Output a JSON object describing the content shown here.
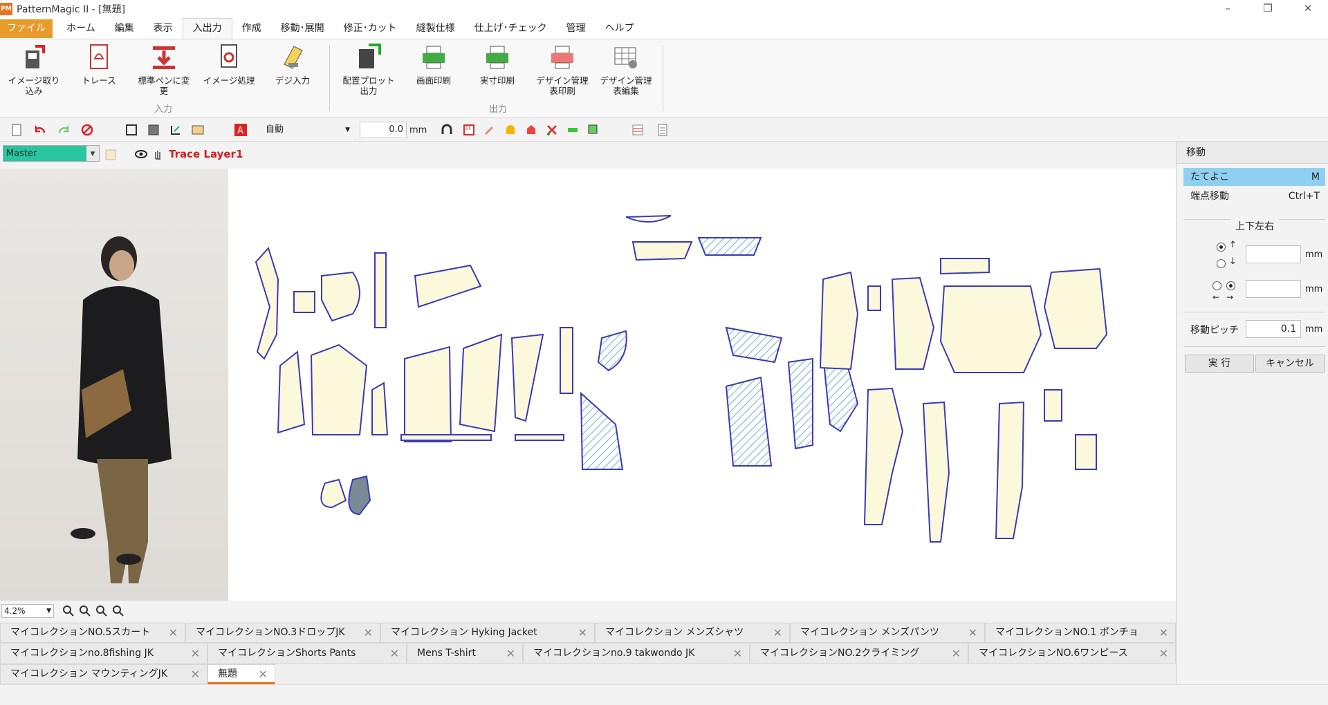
{
  "window": {
    "title": "PatternMagic II - [無題]",
    "app_icon_text": "PM"
  },
  "menu": [
    "ファイル",
    "ホーム",
    "編集",
    "表示",
    "入出力",
    "作成",
    "移動･展開",
    "修正･カット",
    "縫製仕様",
    "仕上げ･チェック",
    "管理",
    "ヘルプ"
  ],
  "ribbon": {
    "input_group_label": "入力",
    "output_group_label": "出力",
    "buttons": {
      "image_import": "イメージ取り込み",
      "trace": "トレース",
      "standard_pen": "標準ペンに変更",
      "image_process": "イメージ処理",
      "digitizer": "デジ入力",
      "plot_output": "配置プロット出力",
      "screen_print": "画面印刷",
      "actual_print": "実寸印刷",
      "design_print": "デザイン管理表印刷",
      "design_edit": "デザイン管理表編集"
    }
  },
  "toolbar": {
    "mode_value": "自動",
    "length_value": "0.0",
    "length_unit": "mm"
  },
  "layer": {
    "master_value": "Master",
    "layer_name": "Trace Layer1"
  },
  "zoom": {
    "value": "4.2%"
  },
  "tabs": {
    "row1": [
      "マイコレクションNO.5スカート",
      "マイコレクションNO.3ドロップJK",
      "マイコレクション Hyking Jacket",
      "マイコレクション メンズシャツ",
      "マイコレクション メンズパンツ",
      "マイコレクションNO.1 ポンチョ"
    ],
    "row2": [
      "マイコレクションno.8fishing JK",
      "マイコレクションShorts Pants",
      "Mens T-shirt",
      "マイコレクションno.9 takwondo JK",
      "マイコレクションNO.2クライミング",
      "マイコレクションNO.6ワンピース"
    ],
    "row3": [
      "マイコレクション マウンティングJK",
      "無題"
    ]
  },
  "panel": {
    "title": "移動",
    "items": [
      {
        "label": "たてよこ",
        "shortcut": "M"
      },
      {
        "label": "端点移動",
        "shortcut": "Ctrl+T"
      }
    ],
    "direction_label": "上下左右",
    "vertical_arrows": [
      "↑",
      "↓"
    ],
    "horizontal_arrows": [
      "←",
      "→"
    ],
    "unit": "mm",
    "pitch_label": "移動ピッチ",
    "pitch_value": "0.1",
    "execute_label": "実 行",
    "cancel_label": "キャンセル"
  },
  "colors": {
    "accent": "#e8731e",
    "file_menu": "#e89a2a",
    "master_bg": "#2bc4a0",
    "selected_item": "#8fd0f2",
    "piece_fill": "#fbf8dc",
    "piece_stroke": "#3a3ab8",
    "layer_name": "#cf2020"
  }
}
